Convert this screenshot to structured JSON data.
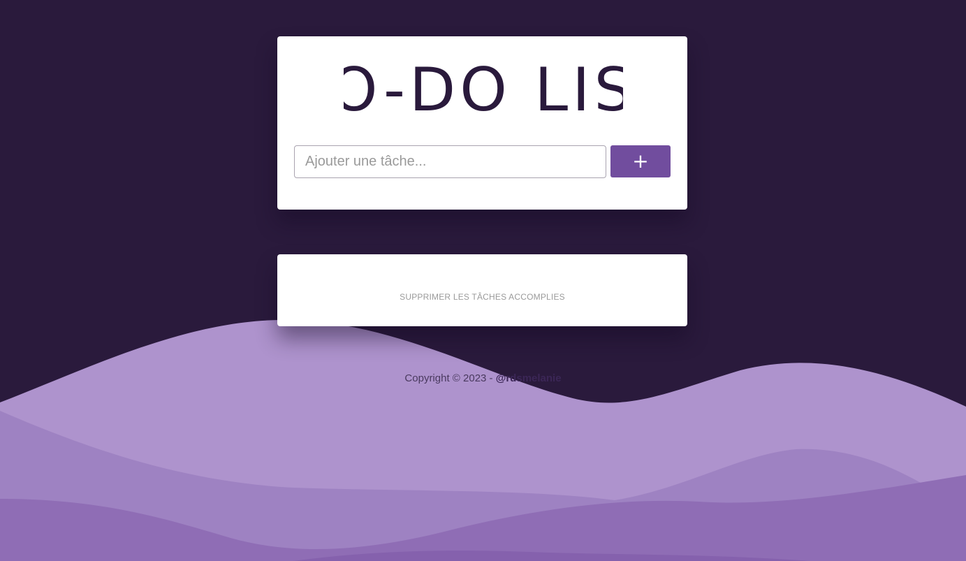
{
  "app": {
    "title": "TO-DO LIST"
  },
  "input": {
    "placeholder": "Ajouter une tâche...",
    "value": ""
  },
  "add_button": {
    "label": "+"
  },
  "actions": {
    "clear_completed_label": "SUPPRIMER LES TÂCHES ACCOMPLIES"
  },
  "footer": {
    "copyright": "Copyright © 2023 - ",
    "handle": "@rdsmelanie"
  },
  "colors": {
    "background": "#2a1a3c",
    "accent": "#714d9e",
    "wave_light": "#ae93cd",
    "wave_mid": "#9b80c1",
    "wave_dark": "#8d6ab3",
    "title_ink": "#2a1a3c"
  }
}
